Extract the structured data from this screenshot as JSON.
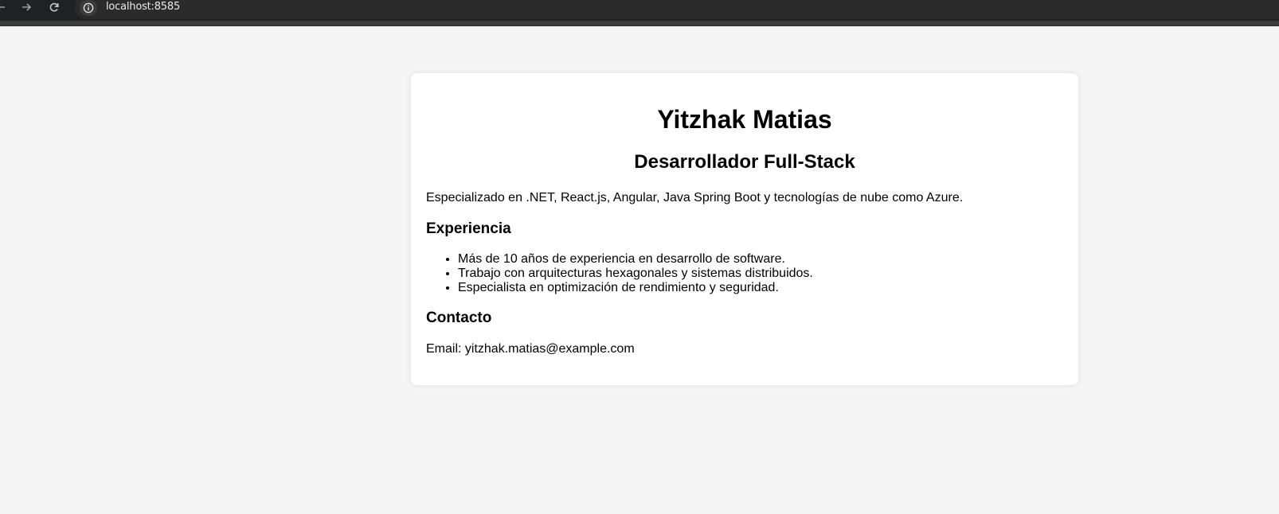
{
  "browser": {
    "url": "localhost:8585"
  },
  "profile": {
    "name": "Yitzhak Matias",
    "role": "Desarrollador Full-Stack",
    "summary": "Especializado en .NET, React.js, Angular, Java Spring Boot y tecnologías de nube como Azure.",
    "experience_heading": "Experiencia",
    "experience": [
      "Más de 10 años de experiencia en desarrollo de software.",
      "Trabajo con arquitecturas hexagonales y sistemas distribuidos.",
      "Especialista en optimización de rendimiento y seguridad."
    ],
    "contact_heading": "Contacto",
    "email_line": "Email: yitzhak.matias@example.com"
  },
  "icons": {
    "back": "arrow-left-icon",
    "forward": "arrow-right-icon",
    "reload": "reload-icon",
    "site_info": "info-icon"
  },
  "colors": {
    "page_background": "#f4f4f4",
    "card_background": "#ffffff",
    "browser_bar": "#202124",
    "text": "#000000"
  }
}
